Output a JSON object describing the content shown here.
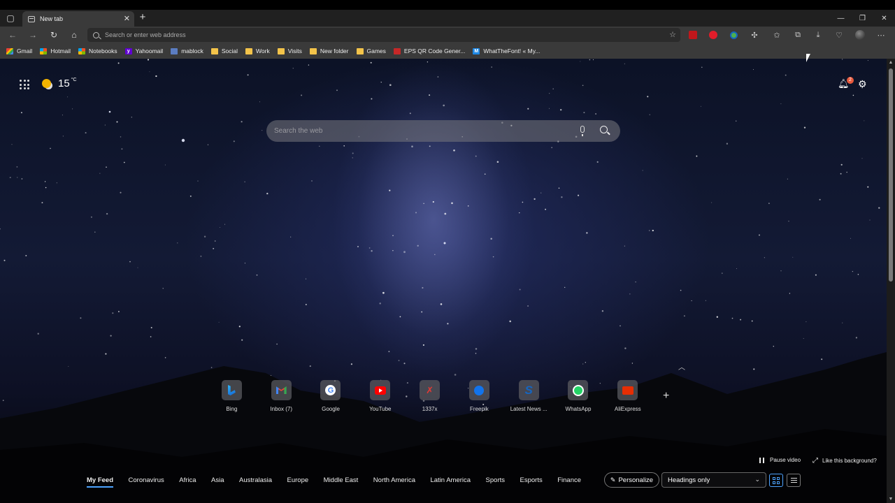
{
  "tabs": [
    {
      "title": "New tab"
    }
  ],
  "address_bar": {
    "placeholder": "Search or enter web address"
  },
  "bookmarks": [
    {
      "label": "Gmail",
      "icon": "gmail-icon"
    },
    {
      "label": "Hotmail",
      "icon": "microsoft-icon"
    },
    {
      "label": "Notebooks",
      "icon": "microsoft-icon"
    },
    {
      "label": "Yahoomail",
      "icon": "yahoo-icon"
    },
    {
      "label": "mablock",
      "icon": "doc-icon"
    },
    {
      "label": "Social",
      "icon": "folder-icon"
    },
    {
      "label": "Work",
      "icon": "folder-icon"
    },
    {
      "label": "Visits",
      "icon": "folder-icon"
    },
    {
      "label": "New folder",
      "icon": "folder-icon"
    },
    {
      "label": "Games",
      "icon": "folder-icon"
    },
    {
      "label": "EPS QR Code Gener...",
      "icon": "eps-icon"
    },
    {
      "label": "WhatTheFont! « My...",
      "icon": "whatthefont-icon"
    }
  ],
  "weather": {
    "temperature": "15",
    "unit": "°C"
  },
  "notifications": {
    "count": "2"
  },
  "search": {
    "placeholder": "Search the web"
  },
  "quick_links": [
    {
      "label": "Bing",
      "icon": "bing-icon"
    },
    {
      "label": "Inbox (7)",
      "icon": "gmail-icon"
    },
    {
      "label": "Google",
      "icon": "google-icon"
    },
    {
      "label": "YouTube",
      "icon": "youtube-icon"
    },
    {
      "label": "1337x",
      "icon": "x-icon"
    },
    {
      "label": "Freepik",
      "icon": "freepik-icon"
    },
    {
      "label": "Latest News ...",
      "icon": "s-icon"
    },
    {
      "label": "WhatsApp",
      "icon": "whatsapp-icon"
    },
    {
      "label": "AliExpress",
      "icon": "aliexpress-icon"
    }
  ],
  "background_controls": {
    "pause": "Pause video",
    "like": "Like this background?"
  },
  "feed_tabs": [
    "My Feed",
    "Coronavirus",
    "Africa",
    "Asia",
    "Australasia",
    "Europe",
    "Middle East",
    "North America",
    "Latin America",
    "Sports",
    "Esports",
    "Finance"
  ],
  "personalize": {
    "label": "Personalize"
  },
  "layout_select": {
    "value": "Headings only"
  },
  "colors": {
    "accent": "#4da3ff",
    "chrome": "#3a3a3a",
    "titlebar": "#202020"
  }
}
